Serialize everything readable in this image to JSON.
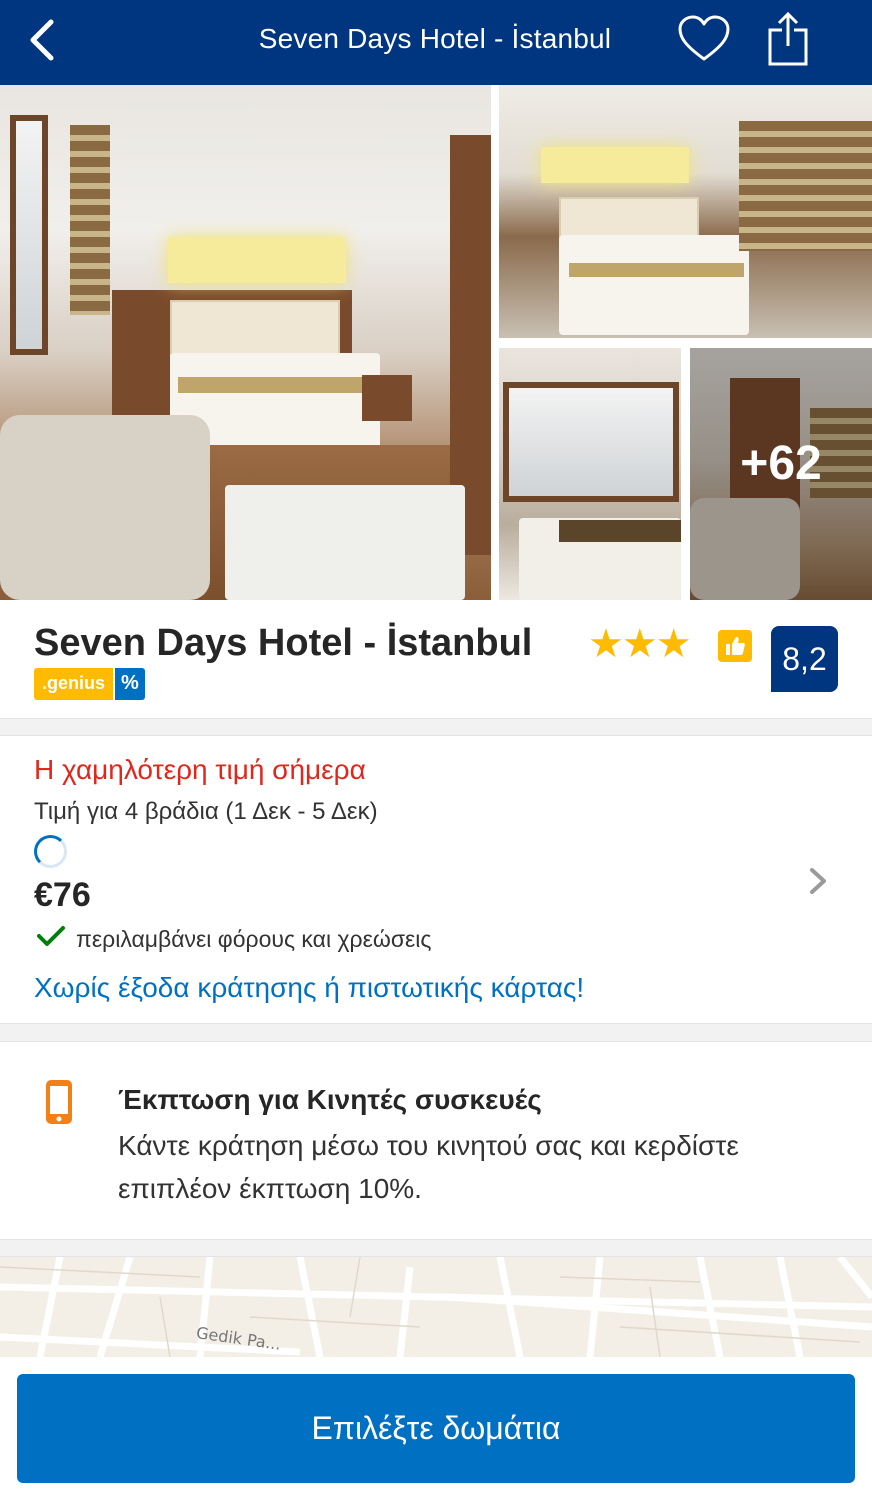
{
  "header": {
    "title": "Seven Days Hotel - İstanbul",
    "back_icon": "chevron-left-icon",
    "favorite_icon": "heart-outline-icon",
    "share_icon": "share-icon",
    "background": "#003580"
  },
  "gallery": {
    "more_photos_label": "+62"
  },
  "hotel": {
    "name": "Seven Days Hotel - İstanbul",
    "stars": "★★★",
    "star_count": 3,
    "genius_label": ".genius",
    "genius_discount_symbol": "%",
    "score": "8,2",
    "star_color": "#febb02"
  },
  "price": {
    "lowest_label": "Η χαμηλότερη τιμή σήμερα",
    "nights_label": "Τιμή για 4 βράδια (1 Δεκ - 5 Δεκ)",
    "amount": "€76",
    "taxes_label": "περιλαμβάνει φόρους και χρεώσεις",
    "no_fee_label": "Χωρίς έξοδα κράτησης ή πιστωτικής κάρτας!",
    "lowest_color": "#e3261c",
    "link_color": "#0071c2"
  },
  "promo": {
    "icon": "mobile-phone-icon",
    "title": "Έκπτωση για Κινητές συσκευές",
    "text": "Κάντε κράτηση μέσω του κινητού σας και κερδίστε επιπλέον έκπτωση 10%."
  },
  "map": {
    "street_label": "Gedik Pa..."
  },
  "cta": {
    "label": "Επιλέξτε δωμάτια",
    "color": "#0071c2"
  }
}
